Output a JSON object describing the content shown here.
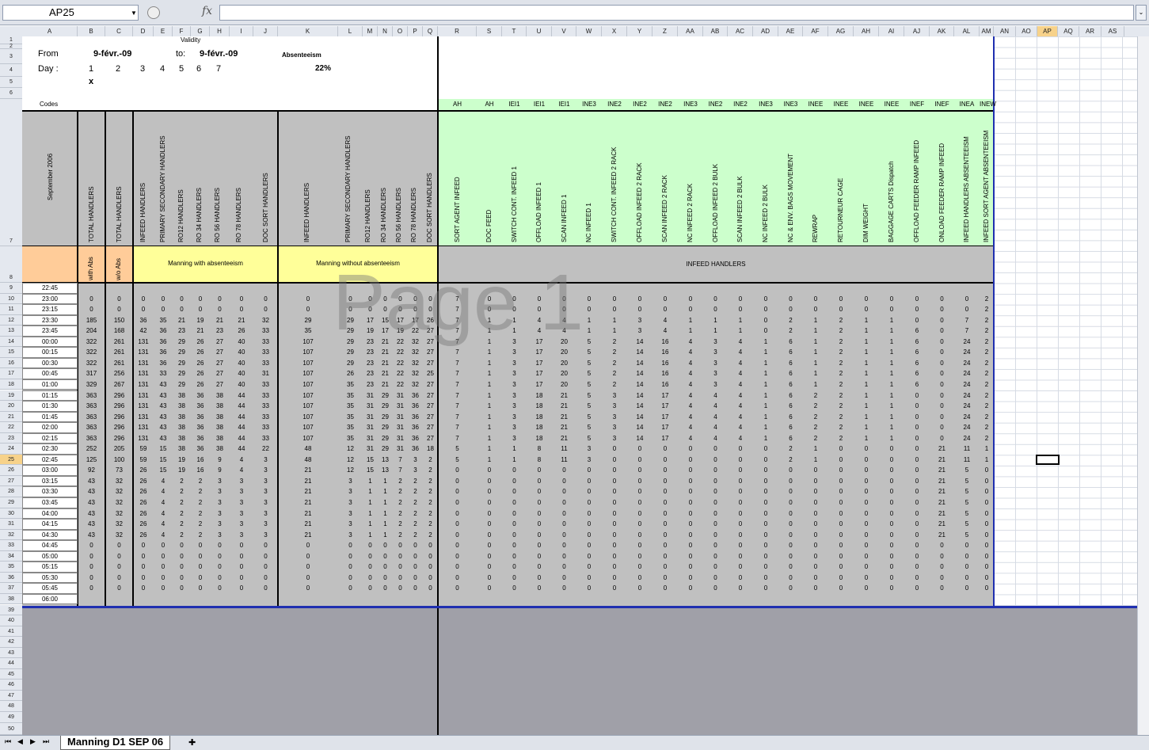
{
  "name_box": "AP25",
  "formula_icon": "fx",
  "columns": [
    "A",
    "B",
    "C",
    "D",
    "E",
    "F",
    "G",
    "H",
    "I",
    "J",
    "K",
    "L",
    "M",
    "N",
    "O",
    "P",
    "Q",
    "R",
    "S",
    "T",
    "U",
    "V",
    "W",
    "X",
    "Y",
    "Z",
    "AA",
    "AB",
    "AC",
    "AD",
    "AE",
    "AF",
    "AG",
    "AH",
    "AI",
    "AJ",
    "AK",
    "AL",
    "AM",
    "AN",
    "AO",
    "AP",
    "AQ",
    "AR",
    "AS"
  ],
  "rows": [
    "1",
    "2",
    "3",
    "4",
    "5",
    "6",
    "7",
    "8",
    "9",
    "10",
    "11",
    "12",
    "13",
    "14",
    "15",
    "16",
    "17",
    "18",
    "19",
    "20",
    "21",
    "22",
    "23",
    "24",
    "25",
    "26",
    "27",
    "28",
    "29",
    "30",
    "31",
    "32",
    "33",
    "34",
    "35",
    "36",
    "37",
    "38",
    "39",
    "40",
    "41",
    "42",
    "43",
    "44",
    "45",
    "46",
    "47",
    "48",
    "49",
    "50"
  ],
  "header": {
    "validity": "Validity",
    "from_label": "From",
    "from_date": "9-févr.-09",
    "to_label": "to:",
    "to_date": "9-févr.-09",
    "absenteeism_label": "Absenteeism",
    "absenteeism_value": "22%",
    "day_label": "Day :",
    "days": [
      "1",
      "2",
      "3",
      "4",
      "5",
      "6",
      "7"
    ],
    "day_mark": "x",
    "codes_label": "Codes"
  },
  "codes": [
    "AH",
    "AH",
    "IEI1",
    "IEI1",
    "IEI1",
    "INE3",
    "INE2",
    "INE2",
    "INE2",
    "INE3",
    "INE2",
    "INE2",
    "INE3",
    "INE3",
    "INEE",
    "INEE",
    "INEE",
    "INEE",
    "INEF",
    "INEF",
    "INEA",
    "INEW"
  ],
  "vertical_headers_left": [
    "September 2006",
    "TOTAL HANDLERS",
    "TOTAL HANDLERS",
    "INFEED HANDLERS",
    "PRIMARY SECONDARY HANDLERS",
    "RO12 HANDLERS",
    "RO 34 HANDLERS",
    "RO 56 HANDLERS",
    "RO 78 HANDLERS",
    "DOC SORT HANDLERS",
    "INFEED HANDLERS",
    "PRIMARY SECONDARY HANDLERS",
    "RO12 HANDLERS",
    "RO 34 HANDLERS",
    "RO 56 HANDLERS",
    "RO 78 HANDLERS",
    "DOC SORT HANDLERS"
  ],
  "vertical_headers_green": [
    "SORT AGENT INFEED",
    "DOC FEED",
    "SWITCH CONT. INFEED 1",
    "OFFLOAD INFEED 1",
    "SCAN INFEED 1",
    "NC INFEED 1",
    "SWITCH CONT. INFEED 2 RACK",
    "OFFLOAD INFEED 2 RACK",
    "SCAN INFEED 2 RACK",
    "NC INFEED 2 RACK",
    "OFFLOAD INFEED 2 BULK",
    "SCAN INFEED 2 BULK",
    "NC INFEED 2 BULK",
    "NC & ENV. BAGS MOVEMENT",
    "REWRAP",
    "RETOURNEUR CAGE",
    "DIM WEIGHT",
    "BAGGAGE CARTS Dispatch",
    "OFFLOAD FEEDER RAMP INFEED",
    "ONLOAD FEEDER RAMP INFEED",
    "INFEED HANDLERS ABSENTEEISM",
    "INFEED SORT AGENT ABSENTEEISM"
  ],
  "row8": {
    "with_abs": "with Abs",
    "wo_abs": "w/o Abs",
    "manning_with": "Manning with absenteeism",
    "manning_without": "Manning without absenteeism",
    "infeed_handlers": "INFEED HANDLERS"
  },
  "times": [
    "22:45",
    "23:00",
    "23:15",
    "23:30",
    "23:45",
    "00:00",
    "00:15",
    "00:30",
    "00:45",
    "01:00",
    "01:15",
    "01:30",
    "01:45",
    "02:00",
    "02:15",
    "02:30",
    "02:45",
    "03:00",
    "03:15",
    "03:30",
    "03:45",
    "04:00",
    "04:15",
    "04:30",
    "04:45",
    "05:00",
    "05:15",
    "05:30",
    "05:45",
    "06:00"
  ],
  "data_rows": [
    [],
    [
      0,
      0,
      0,
      0,
      0,
      0,
      0,
      0,
      0,
      0,
      0,
      0,
      0,
      0,
      0,
      0,
      7,
      0,
      0,
      0,
      0,
      0,
      0,
      0,
      0,
      0,
      0,
      0,
      0,
      0,
      0,
      0,
      0,
      0,
      0,
      0,
      0,
      2
    ],
    [
      0,
      0,
      0,
      0,
      0,
      0,
      0,
      0,
      0,
      0,
      0,
      0,
      0,
      0,
      0,
      0,
      7,
      0,
      0,
      0,
      0,
      0,
      0,
      0,
      0,
      0,
      0,
      0,
      0,
      0,
      0,
      0,
      0,
      0,
      0,
      0,
      0,
      2
    ],
    [
      185,
      150,
      36,
      35,
      21,
      19,
      21,
      21,
      32,
      29,
      29,
      17,
      15,
      17,
      17,
      26,
      7,
      1,
      1,
      4,
      4,
      1,
      1,
      3,
      4,
      1,
      1,
      1,
      0,
      2,
      1,
      2,
      1,
      1,
      0,
      0,
      7,
      2
    ],
    [
      204,
      168,
      42,
      36,
      23,
      21,
      23,
      26,
      33,
      35,
      29,
      19,
      17,
      19,
      22,
      27,
      7,
      1,
      1,
      4,
      4,
      1,
      1,
      3,
      4,
      1,
      1,
      1,
      0,
      2,
      1,
      2,
      1,
      1,
      6,
      0,
      7,
      2
    ],
    [
      322,
      261,
      131,
      36,
      29,
      26,
      27,
      40,
      33,
      107,
      29,
      23,
      21,
      22,
      32,
      27,
      7,
      1,
      3,
      17,
      20,
      5,
      2,
      14,
      16,
      4,
      3,
      4,
      1,
      6,
      1,
      2,
      1,
      1,
      6,
      0,
      24,
      2
    ],
    [
      322,
      261,
      131,
      36,
      29,
      26,
      27,
      40,
      33,
      107,
      29,
      23,
      21,
      22,
      32,
      27,
      7,
      1,
      3,
      17,
      20,
      5,
      2,
      14,
      16,
      4,
      3,
      4,
      1,
      6,
      1,
      2,
      1,
      1,
      6,
      0,
      24,
      2
    ],
    [
      322,
      261,
      131,
      36,
      29,
      26,
      27,
      40,
      33,
      107,
      29,
      23,
      21,
      22,
      32,
      27,
      7,
      1,
      3,
      17,
      20,
      5,
      2,
      14,
      16,
      4,
      3,
      4,
      1,
      6,
      1,
      2,
      1,
      1,
      6,
      0,
      24,
      2
    ],
    [
      317,
      256,
      131,
      33,
      29,
      26,
      27,
      40,
      31,
      107,
      26,
      23,
      21,
      22,
      32,
      25,
      7,
      1,
      3,
      17,
      20,
      5,
      2,
      14,
      16,
      4,
      3,
      4,
      1,
      6,
      1,
      2,
      1,
      1,
      6,
      0,
      24,
      2
    ],
    [
      329,
      267,
      131,
      43,
      29,
      26,
      27,
      40,
      33,
      107,
      35,
      23,
      21,
      22,
      32,
      27,
      7,
      1,
      3,
      17,
      20,
      5,
      2,
      14,
      16,
      4,
      3,
      4,
      1,
      6,
      1,
      2,
      1,
      1,
      6,
      0,
      24,
      2
    ],
    [
      363,
      296,
      131,
      43,
      38,
      36,
      38,
      44,
      33,
      107,
      35,
      31,
      29,
      31,
      36,
      27,
      7,
      1,
      3,
      18,
      21,
      5,
      3,
      14,
      17,
      4,
      4,
      4,
      1,
      6,
      2,
      2,
      1,
      1,
      0,
      0,
      24,
      2
    ],
    [
      363,
      296,
      131,
      43,
      38,
      36,
      38,
      44,
      33,
      107,
      35,
      31,
      29,
      31,
      36,
      27,
      7,
      1,
      3,
      18,
      21,
      5,
      3,
      14,
      17,
      4,
      4,
      4,
      1,
      6,
      2,
      2,
      1,
      1,
      0,
      0,
      24,
      2
    ],
    [
      363,
      296,
      131,
      43,
      38,
      36,
      38,
      44,
      33,
      107,
      35,
      31,
      29,
      31,
      36,
      27,
      7,
      1,
      3,
      18,
      21,
      5,
      3,
      14,
      17,
      4,
      4,
      4,
      1,
      6,
      2,
      2,
      1,
      1,
      0,
      0,
      24,
      2
    ],
    [
      363,
      296,
      131,
      43,
      38,
      36,
      38,
      44,
      33,
      107,
      35,
      31,
      29,
      31,
      36,
      27,
      7,
      1,
      3,
      18,
      21,
      5,
      3,
      14,
      17,
      4,
      4,
      4,
      1,
      6,
      2,
      2,
      1,
      1,
      0,
      0,
      24,
      2
    ],
    [
      363,
      296,
      131,
      43,
      38,
      36,
      38,
      44,
      33,
      107,
      35,
      31,
      29,
      31,
      36,
      27,
      7,
      1,
      3,
      18,
      21,
      5,
      3,
      14,
      17,
      4,
      4,
      4,
      1,
      6,
      2,
      2,
      1,
      1,
      0,
      0,
      24,
      2
    ],
    [
      252,
      205,
      59,
      15,
      38,
      36,
      38,
      44,
      22,
      48,
      12,
      31,
      29,
      31,
      36,
      18,
      5,
      1,
      1,
      8,
      11,
      3,
      0,
      0,
      0,
      0,
      0,
      0,
      0,
      2,
      1,
      0,
      0,
      0,
      0,
      21,
      11,
      1
    ],
    [
      125,
      100,
      59,
      15,
      19,
      16,
      9,
      4,
      3,
      48,
      12,
      15,
      13,
      7,
      3,
      2,
      5,
      1,
      1,
      8,
      11,
      3,
      0,
      0,
      0,
      0,
      0,
      0,
      0,
      2,
      1,
      0,
      0,
      0,
      0,
      21,
      11,
      1
    ],
    [
      92,
      73,
      26,
      15,
      19,
      16,
      9,
      4,
      3,
      21,
      12,
      15,
      13,
      7,
      3,
      2,
      0,
      0,
      0,
      0,
      0,
      0,
      0,
      0,
      0,
      0,
      0,
      0,
      0,
      0,
      0,
      0,
      0,
      0,
      0,
      21,
      5,
      0
    ],
    [
      43,
      32,
      26,
      4,
      2,
      2,
      3,
      3,
      3,
      21,
      3,
      1,
      1,
      2,
      2,
      2,
      0,
      0,
      0,
      0,
      0,
      0,
      0,
      0,
      0,
      0,
      0,
      0,
      0,
      0,
      0,
      0,
      0,
      0,
      0,
      21,
      5,
      0
    ],
    [
      43,
      32,
      26,
      4,
      2,
      2,
      3,
      3,
      3,
      21,
      3,
      1,
      1,
      2,
      2,
      2,
      0,
      0,
      0,
      0,
      0,
      0,
      0,
      0,
      0,
      0,
      0,
      0,
      0,
      0,
      0,
      0,
      0,
      0,
      0,
      21,
      5,
      0
    ],
    [
      43,
      32,
      26,
      4,
      2,
      2,
      3,
      3,
      3,
      21,
      3,
      1,
      1,
      2,
      2,
      2,
      0,
      0,
      0,
      0,
      0,
      0,
      0,
      0,
      0,
      0,
      0,
      0,
      0,
      0,
      0,
      0,
      0,
      0,
      0,
      21,
      5,
      0
    ],
    [
      43,
      32,
      26,
      4,
      2,
      2,
      3,
      3,
      3,
      21,
      3,
      1,
      1,
      2,
      2,
      2,
      0,
      0,
      0,
      0,
      0,
      0,
      0,
      0,
      0,
      0,
      0,
      0,
      0,
      0,
      0,
      0,
      0,
      0,
      0,
      21,
      5,
      0
    ],
    [
      43,
      32,
      26,
      4,
      2,
      2,
      3,
      3,
      3,
      21,
      3,
      1,
      1,
      2,
      2,
      2,
      0,
      0,
      0,
      0,
      0,
      0,
      0,
      0,
      0,
      0,
      0,
      0,
      0,
      0,
      0,
      0,
      0,
      0,
      0,
      21,
      5,
      0
    ],
    [
      43,
      32,
      26,
      4,
      2,
      2,
      3,
      3,
      3,
      21,
      3,
      1,
      1,
      2,
      2,
      2,
      0,
      0,
      0,
      0,
      0,
      0,
      0,
      0,
      0,
      0,
      0,
      0,
      0,
      0,
      0,
      0,
      0,
      0,
      0,
      21,
      5,
      0
    ],
    [
      0,
      0,
      0,
      0,
      0,
      0,
      0,
      0,
      0,
      0,
      0,
      0,
      0,
      0,
      0,
      0,
      0,
      0,
      0,
      0,
      0,
      0,
      0,
      0,
      0,
      0,
      0,
      0,
      0,
      0,
      0,
      0,
      0,
      0,
      0,
      0,
      0,
      0
    ],
    [
      0,
      0,
      0,
      0,
      0,
      0,
      0,
      0,
      0,
      0,
      0,
      0,
      0,
      0,
      0,
      0,
      0,
      0,
      0,
      0,
      0,
      0,
      0,
      0,
      0,
      0,
      0,
      0,
      0,
      0,
      0,
      0,
      0,
      0,
      0,
      0,
      0,
      0
    ],
    [
      0,
      0,
      0,
      0,
      0,
      0,
      0,
      0,
      0,
      0,
      0,
      0,
      0,
      0,
      0,
      0,
      0,
      0,
      0,
      0,
      0,
      0,
      0,
      0,
      0,
      0,
      0,
      0,
      0,
      0,
      0,
      0,
      0,
      0,
      0,
      0,
      0,
      0
    ],
    [
      0,
      0,
      0,
      0,
      0,
      0,
      0,
      0,
      0,
      0,
      0,
      0,
      0,
      0,
      0,
      0,
      0,
      0,
      0,
      0,
      0,
      0,
      0,
      0,
      0,
      0,
      0,
      0,
      0,
      0,
      0,
      0,
      0,
      0,
      0,
      0,
      0,
      0
    ],
    [
      0,
      0,
      0,
      0,
      0,
      0,
      0,
      0,
      0,
      0,
      0,
      0,
      0,
      0,
      0,
      0,
      0,
      0,
      0,
      0,
      0,
      0,
      0,
      0,
      0,
      0,
      0,
      0,
      0,
      0,
      0,
      0,
      0,
      0,
      0,
      0,
      0,
      0
    ],
    []
  ],
  "watermark": "Page 1",
  "sheet_tab": "Manning D1 SEP 06",
  "colors": {
    "green": "#ccffcc",
    "yellow": "#ffff99",
    "orange": "#ffcc99",
    "gray": "#c0c0c0",
    "darkgray": "#a0a0a8",
    "blue": "#1f2fb0"
  }
}
